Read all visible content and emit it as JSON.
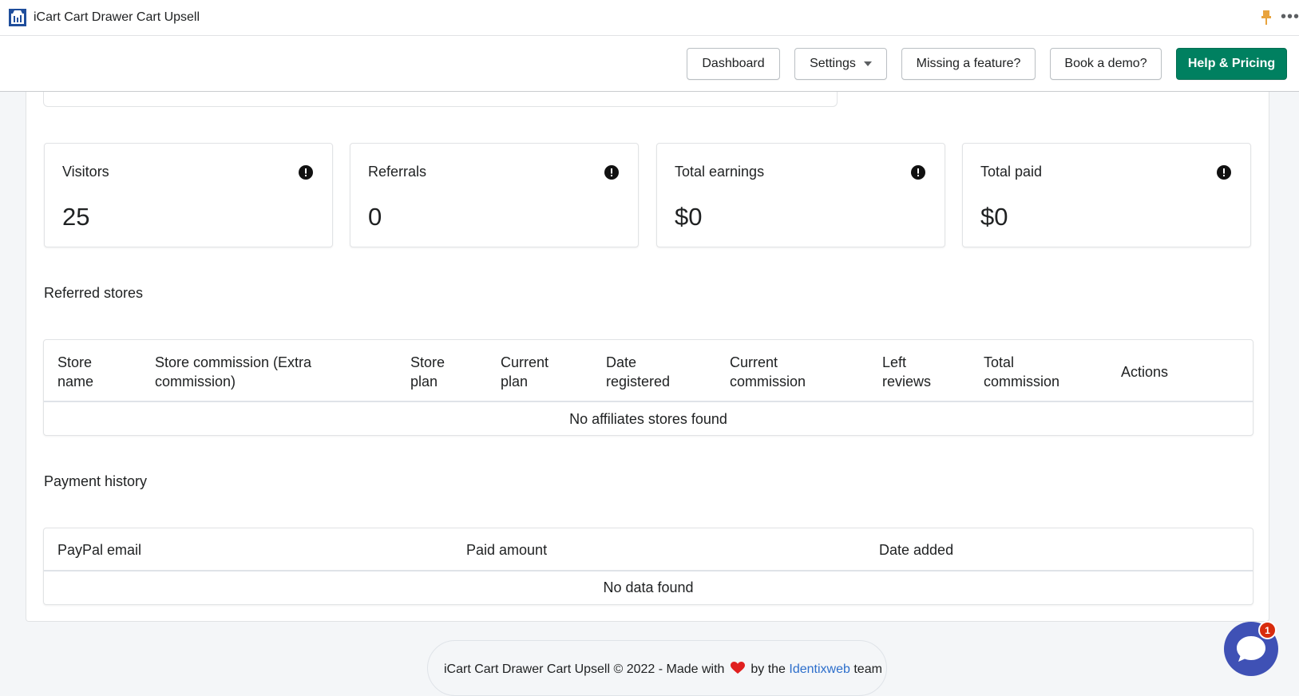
{
  "app": {
    "title": "iCart Cart Drawer Cart Upsell",
    "logo_icon": "store-logo-icon",
    "more_label": "•••"
  },
  "header": {
    "dashboard_label": "Dashboard",
    "settings_label": "Settings",
    "missing_feature_label": "Missing a feature?",
    "book_demo_label": "Book a demo?",
    "help_pricing_label": "Help & Pricing",
    "primary_color": "#008060"
  },
  "stats": [
    {
      "label": "Visitors",
      "value": "25"
    },
    {
      "label": "Referrals",
      "value": "0"
    },
    {
      "label": "Total earnings",
      "value": "$0"
    },
    {
      "label": "Total paid",
      "value": "$0"
    }
  ],
  "referred_stores": {
    "title": "Referred stores",
    "columns": [
      {
        "line1": "Store",
        "line2": "name"
      },
      {
        "line1": "Store commission (Extra",
        "line2": "commission)"
      },
      {
        "line1": "Store",
        "line2": "plan"
      },
      {
        "line1": "Current",
        "line2": "plan"
      },
      {
        "line1": "Date",
        "line2": "registered"
      },
      {
        "line1": "Current",
        "line2": "commission"
      },
      {
        "line1": "Left",
        "line2": "reviews"
      },
      {
        "line1": "Total",
        "line2": "commission"
      },
      {
        "line1": "Actions",
        "line2": ""
      }
    ],
    "empty_message": "No affiliates stores found"
  },
  "payment_history": {
    "title": "Payment history",
    "columns": [
      "PayPal email",
      "Paid amount",
      "Date added"
    ],
    "empty_message": "No data found"
  },
  "footer": {
    "text_before": "iCart Cart Drawer Cart Upsell © 2022 - Made with",
    "text_by": "by the",
    "link": "Identixweb",
    "text_after": "team",
    "heart_color": "#e02020",
    "link_color": "#2c6ecb"
  },
  "chat": {
    "badge_count": "1",
    "color": "#3f51b5"
  }
}
